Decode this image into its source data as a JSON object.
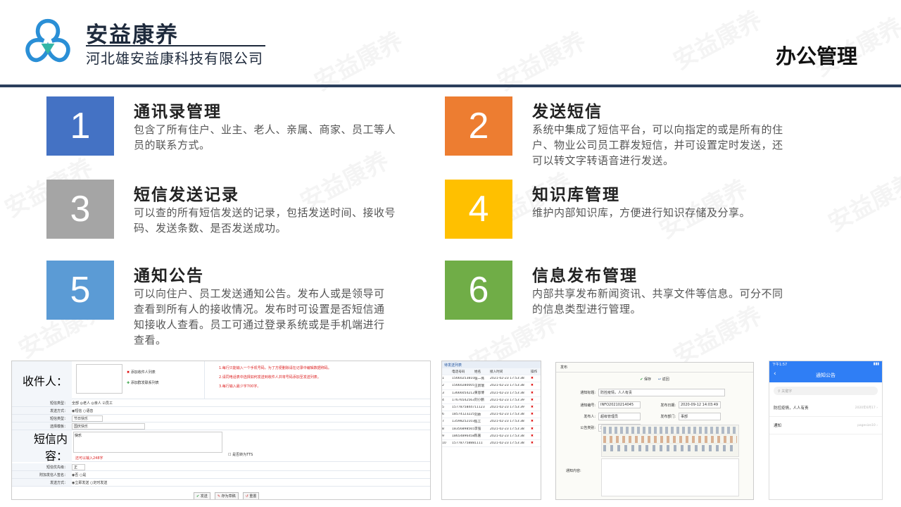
{
  "header": {
    "brand_name": "安益康养",
    "company": "河北雄安益康科技有限公司",
    "page_title": "办公管理"
  },
  "watermark": "安益康养",
  "colors": {
    "blue": "#4472C4",
    "orange": "#ED7D31",
    "gray": "#A5A5A5",
    "yellow": "#FFC000",
    "lightblue": "#5B9BD5",
    "green": "#70AD47",
    "dark": "#2B3F5C"
  },
  "items": [
    {
      "number": "1",
      "title": "通讯录管理",
      "desc": "包含了所有住户、业主、老人、亲属、商家、员工等人员的联系方式。"
    },
    {
      "number": "2",
      "title": "发送短信",
      "desc": "系统中集成了短信平台，可以向指定的或是所有的住户、物业公司员工群发短信，并可设置定时发送，还可以转文字转语音进行发送。"
    },
    {
      "number": "3",
      "title": "短信发送记录",
      "desc": "可以查的所有短信发送的记录，包括发送时间、接收号码、发送条数、是否发送成功。"
    },
    {
      "number": "4",
      "title": "知识库管理",
      "desc": "维护内部知识库，方便进行知识存储及分享。"
    },
    {
      "number": "5",
      "title": "通知公告",
      "desc": "可以向住户、员工发送通知公告。发布人或是领导可查看到所有人的接收情况。发布时可设置是否短信通知接收人查看。员工可通过登录系统或是手机端进行查看。"
    },
    {
      "number": "6",
      "title": "信息发布管理",
      "desc": "内部共享发布新闻资讯、共享文件等信息。可分不同的信息类型进行管理。"
    }
  ],
  "sms_form": {
    "recipient_label": "收件人：",
    "add_recipient_btn": "添加收件人列表",
    "add_group_btn": "添加群发联系列表",
    "tips": [
      "1.每行只能输入一个手机号码，为了方便删除请在记录中编辑数据称码。",
      "2.请同电话表中选择如何发送到收件人并将号码添加至发送列表。",
      "3.每行输入最少字700字。"
    ],
    "rows": [
      {
        "label": "短信类型：",
        "value": "全部 ◎老人 ◎亲人 ☑员工"
      },
      {
        "label": "发送方式：",
        "value": "◉短信 ○语音"
      },
      {
        "label": "短信类型：",
        "value": "节日快乐"
      },
      {
        "label": "选择模板：",
        "value": "国庆快乐"
      },
      {
        "label": "短信内容：",
        "value": "快乐"
      },
      {
        "label": "短信优先级：",
        "value": "正"
      },
      {
        "label": "附加发信人签名：",
        "value": "◉否 ○是"
      },
      {
        "label": "发送方式：",
        "value": "◉立即发送 ○定时发送"
      }
    ],
    "char_count": "还可以输入248字",
    "tts_label": "是否转为TTS",
    "send_btn": "发送",
    "draft_btn": "存为草稿",
    "reset_btn": "重置"
  },
  "sms_list": {
    "title": "待发送列表",
    "headers": [
      "电话号码",
      "姓名",
      "接入时间",
      "操作"
    ],
    "rows": [
      {
        "no": "1",
        "phone": "15660253810",
        "name": "张一伟",
        "time": "2021-02-23 17:53:38"
      },
      {
        "no": "2",
        "phone": "15660280005",
        "name": "王新瑞",
        "time": "2021-02-23 17:53:38"
      },
      {
        "no": "3",
        "phone": "13666054212",
        "name": "黄恩博",
        "time": "2021-02-23 17:53:38"
      },
      {
        "no": "4",
        "phone": "17676542563",
        "name": "刘小鹏",
        "time": "2021-02-23 17:53:39"
      },
      {
        "no": "5",
        "phone": "15778758447",
        "name": "11123",
        "time": "2021-02-23 17:53:39"
      },
      {
        "no": "6",
        "phone": "18574123225",
        "name": "刘帅",
        "time": "2021-02-23 17:53:38"
      },
      {
        "no": "7",
        "phone": "13598252103",
        "name": "陈工",
        "time": "2021-02-23 17:53:38"
      },
      {
        "no": "8",
        "phone": "18356898565",
        "name": "李强",
        "time": "2021-02-23 17:53:38"
      },
      {
        "no": "9",
        "phone": "18654896458",
        "name": "陈嘉",
        "time": "2021-02-23 17:53:38"
      },
      {
        "no": "10",
        "phone": "15778775888",
        "name": "1111",
        "time": "2021-02-23 17:53:38"
      }
    ]
  },
  "notice_form": {
    "tab": "发布",
    "save_btn": "保存",
    "return_btn": "返回",
    "title_label": "通知标题:",
    "title_value": "防控疫情，人人有责",
    "no_label": "通知编号:",
    "no_value": "INFO20210214045",
    "date_label": "发布日期:",
    "date_value": "2020-09-12 14:03:49",
    "publisher_label": "发布人:",
    "publisher_value": "超级管理员",
    "dept_label": "发布部门:",
    "dept_value": "事部",
    "type_label": "公告类别:",
    "type_value": "通知",
    "content_label": "通知内容:"
  },
  "mobile": {
    "status_time": "下午1:57",
    "title": "通知公告",
    "search_placeholder": "关键字",
    "list": [
      {
        "title": "防控疫情，人人有责",
        "meta": "2020年6月17"
      },
      {
        "title": "通知",
        "meta": "pagesize10"
      }
    ]
  }
}
